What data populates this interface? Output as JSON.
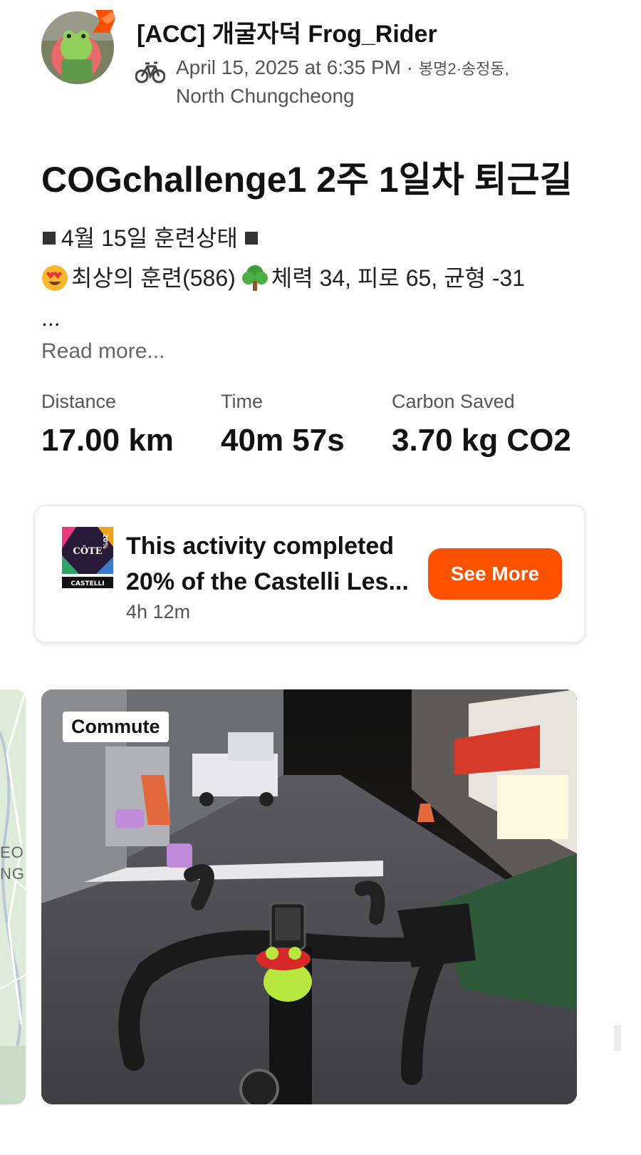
{
  "colors": {
    "accent": "#fc5200",
    "text": "#121212",
    "muted": "#555555"
  },
  "header": {
    "athlete_name": "[ACC] 개굴자덕 Frog_Rider",
    "sport_icon": "bike-icon",
    "datetime": "April 15, 2025 at 6:35 PM",
    "separator": " · ",
    "location_line1": "봉명2·송정동,",
    "location_line2": "North Chungcheong"
  },
  "activity": {
    "title": "COGchallenge1 2주 1일차 퇴근길",
    "desc_line1": "4월 15일 훈련상태",
    "desc_line2_a": "최상의 훈련(586)",
    "desc_line2_b": "체력 34, 피로 65, 균형 -31",
    "desc_line3": "...",
    "read_more": "Read more..."
  },
  "stats": [
    {
      "label": "Distance",
      "value": "17.00 km"
    },
    {
      "label": "Time",
      "value": "40m 57s"
    },
    {
      "label": "Carbon Saved",
      "value": "3.70 kg CO2"
    }
  ],
  "challenge": {
    "line1": "This activity completed",
    "line2": "20% of the Castelli Les...",
    "time": "4h 12m",
    "button": "See More",
    "badge_text": "CÔTE",
    "badge_pct": "20%",
    "badge_brand": "CASTELLI"
  },
  "media": {
    "tag": "Commute",
    "map_label_1": "EO",
    "map_label_2": "NG"
  }
}
